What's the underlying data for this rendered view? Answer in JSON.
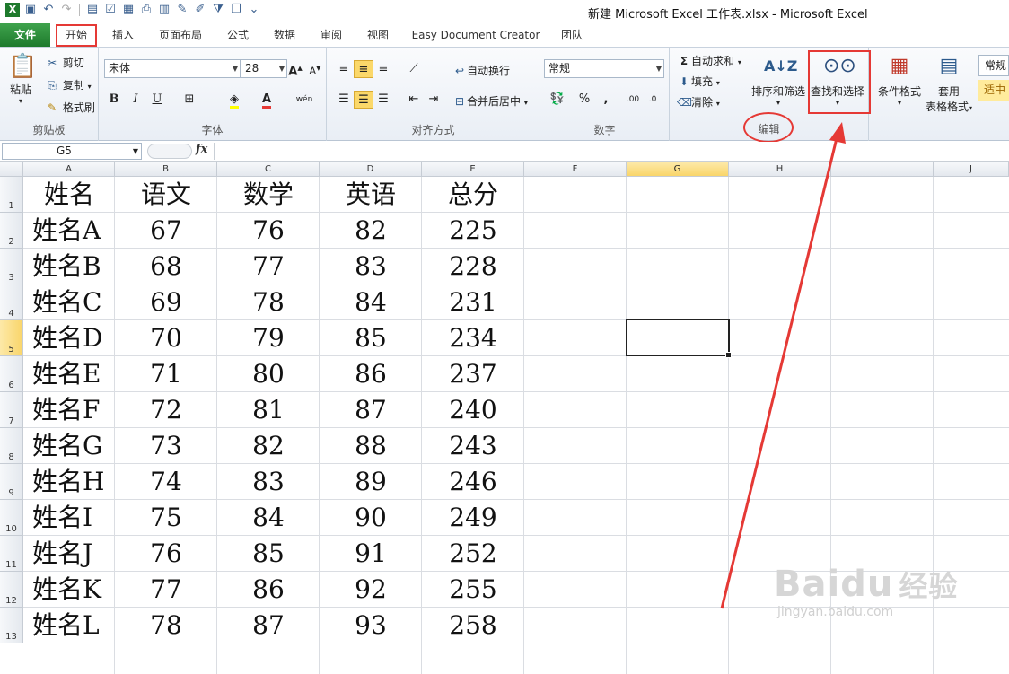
{
  "window": {
    "title": "新建 Microsoft Excel 工作表.xlsx - Microsoft Excel"
  },
  "tabs": [
    {
      "label": "文件"
    },
    {
      "label": "开始"
    },
    {
      "label": "插入"
    },
    {
      "label": "页面布局"
    },
    {
      "label": "公式"
    },
    {
      "label": "数据"
    },
    {
      "label": "审阅"
    },
    {
      "label": "视图"
    },
    {
      "label": "Easy Document Creator"
    },
    {
      "label": "团队"
    }
  ],
  "ribbon": {
    "clipboard": {
      "paste": "粘贴",
      "cut": "剪切",
      "copy": "复制",
      "format_painter": "格式刷",
      "label": "剪贴板"
    },
    "font": {
      "name": "宋体",
      "size": "28",
      "label": "字体",
      "bold": "B",
      "italic": "I",
      "underline": "U",
      "grow": "A",
      "shrink": "A",
      "color": "A",
      "wen": "wén"
    },
    "alignment": {
      "wrap": "自动换行",
      "merge": "合并后居中",
      "label": "对齐方式"
    },
    "number": {
      "format": "常规",
      "percent": "%",
      "comma": ",",
      "label": "数字"
    },
    "editing": {
      "autosum": "自动求和",
      "fill": "填充",
      "clear": "清除",
      "sort_filter": "排序和筛选",
      "find_select": "查找和选择",
      "label": "编辑"
    },
    "styles": {
      "conditional": "条件格式",
      "table_format_1": "套用",
      "table_format_2": "表格格式",
      "style_normal": "常规",
      "style_neutral": "适中"
    }
  },
  "formula_bar": {
    "name_box": "G5",
    "fx": "fx",
    "value": ""
  },
  "columns": [
    "A",
    "B",
    "C",
    "D",
    "E",
    "F",
    "G",
    "H",
    "I",
    "J"
  ],
  "rows": [
    "1",
    "2",
    "3",
    "4",
    "5",
    "6",
    "7",
    "8",
    "9",
    "10",
    "11",
    "12",
    "13"
  ],
  "sheet": {
    "headers": [
      "姓名",
      "语文",
      "数学",
      "英语",
      "总分"
    ],
    "data": [
      [
        "姓名A",
        "67",
        "76",
        "82",
        "225"
      ],
      [
        "姓名B",
        "68",
        "77",
        "83",
        "228"
      ],
      [
        "姓名C",
        "69",
        "78",
        "84",
        "231"
      ],
      [
        "姓名D",
        "70",
        "79",
        "85",
        "234"
      ],
      [
        "姓名E",
        "71",
        "80",
        "86",
        "237"
      ],
      [
        "姓名F",
        "72",
        "81",
        "87",
        "240"
      ],
      [
        "姓名G",
        "73",
        "82",
        "88",
        "243"
      ],
      [
        "姓名H",
        "74",
        "83",
        "89",
        "246"
      ],
      [
        "姓名I",
        "75",
        "84",
        "90",
        "249"
      ],
      [
        "姓名J",
        "76",
        "85",
        "91",
        "252"
      ],
      [
        "姓名K",
        "77",
        "86",
        "92",
        "255"
      ],
      [
        "姓名L",
        "78",
        "87",
        "93",
        "258"
      ]
    ]
  },
  "watermark": {
    "brand": "Baidu",
    "cn": "经验",
    "url": "jingyan.baidu.com"
  },
  "colors": {
    "annotation": "#e53935",
    "file_tab": "#2b8a3e",
    "selected_header": "#f9d56a"
  }
}
